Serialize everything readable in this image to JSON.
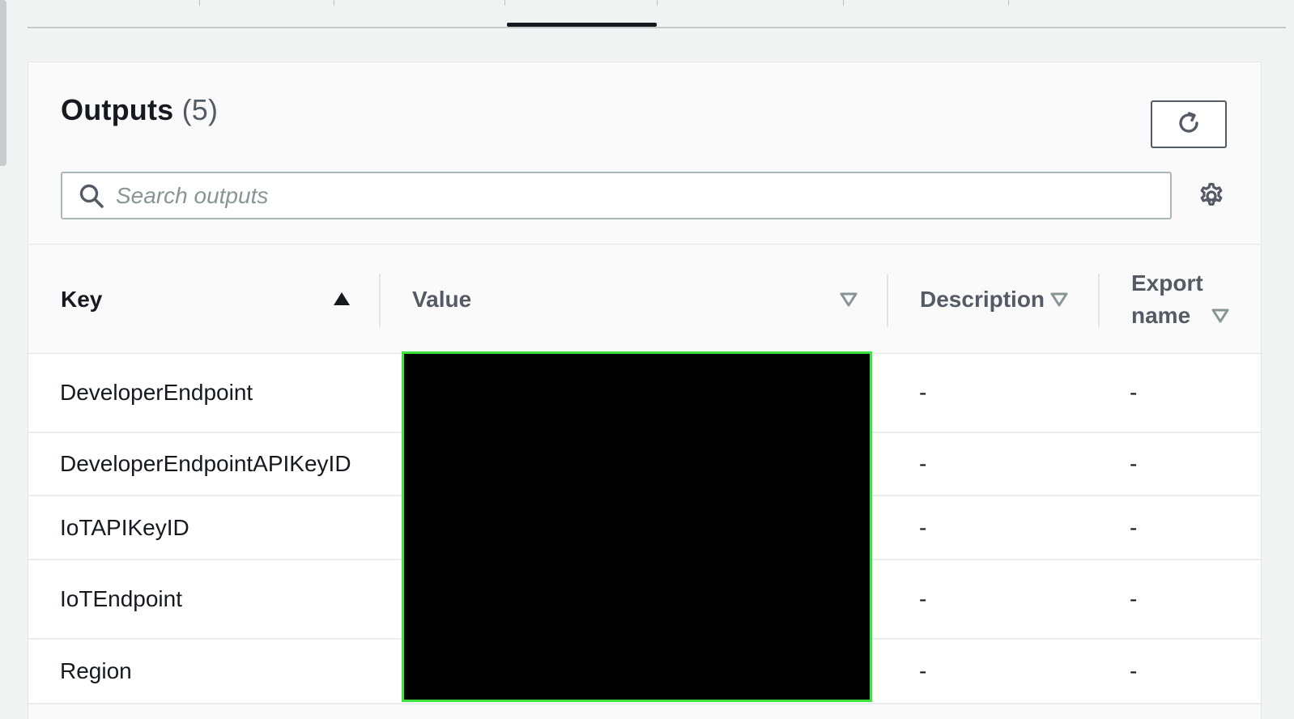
{
  "panel": {
    "title": "Outputs",
    "count": "(5)"
  },
  "search": {
    "placeholder": "Search outputs"
  },
  "columns": {
    "key": "Key",
    "value": "Value",
    "description": "Description",
    "export_name_line1": "Export",
    "export_name_line2": "name"
  },
  "rows": [
    {
      "key": "DeveloperEndpoint",
      "description": "-",
      "export_name": "-"
    },
    {
      "key": "DeveloperEndpointAPIKeyID",
      "description": "-",
      "export_name": "-"
    },
    {
      "key": "IoTAPIKeyID",
      "description": "-",
      "export_name": "-"
    },
    {
      "key": "IoTEndpoint",
      "description": "-",
      "export_name": "-"
    },
    {
      "key": "Region",
      "description": "-",
      "export_name": "-"
    }
  ],
  "icons": {
    "refresh": "refresh-icon",
    "search": "search-icon",
    "settings": "gear-icon",
    "sort_ascending": "caret-up-filled-icon",
    "sort_unsorted": "caret-down-outline-icon"
  },
  "colors": {
    "redaction_fill": "#000000",
    "redaction_border": "#3ee33e",
    "active_tab": "#16191f"
  }
}
